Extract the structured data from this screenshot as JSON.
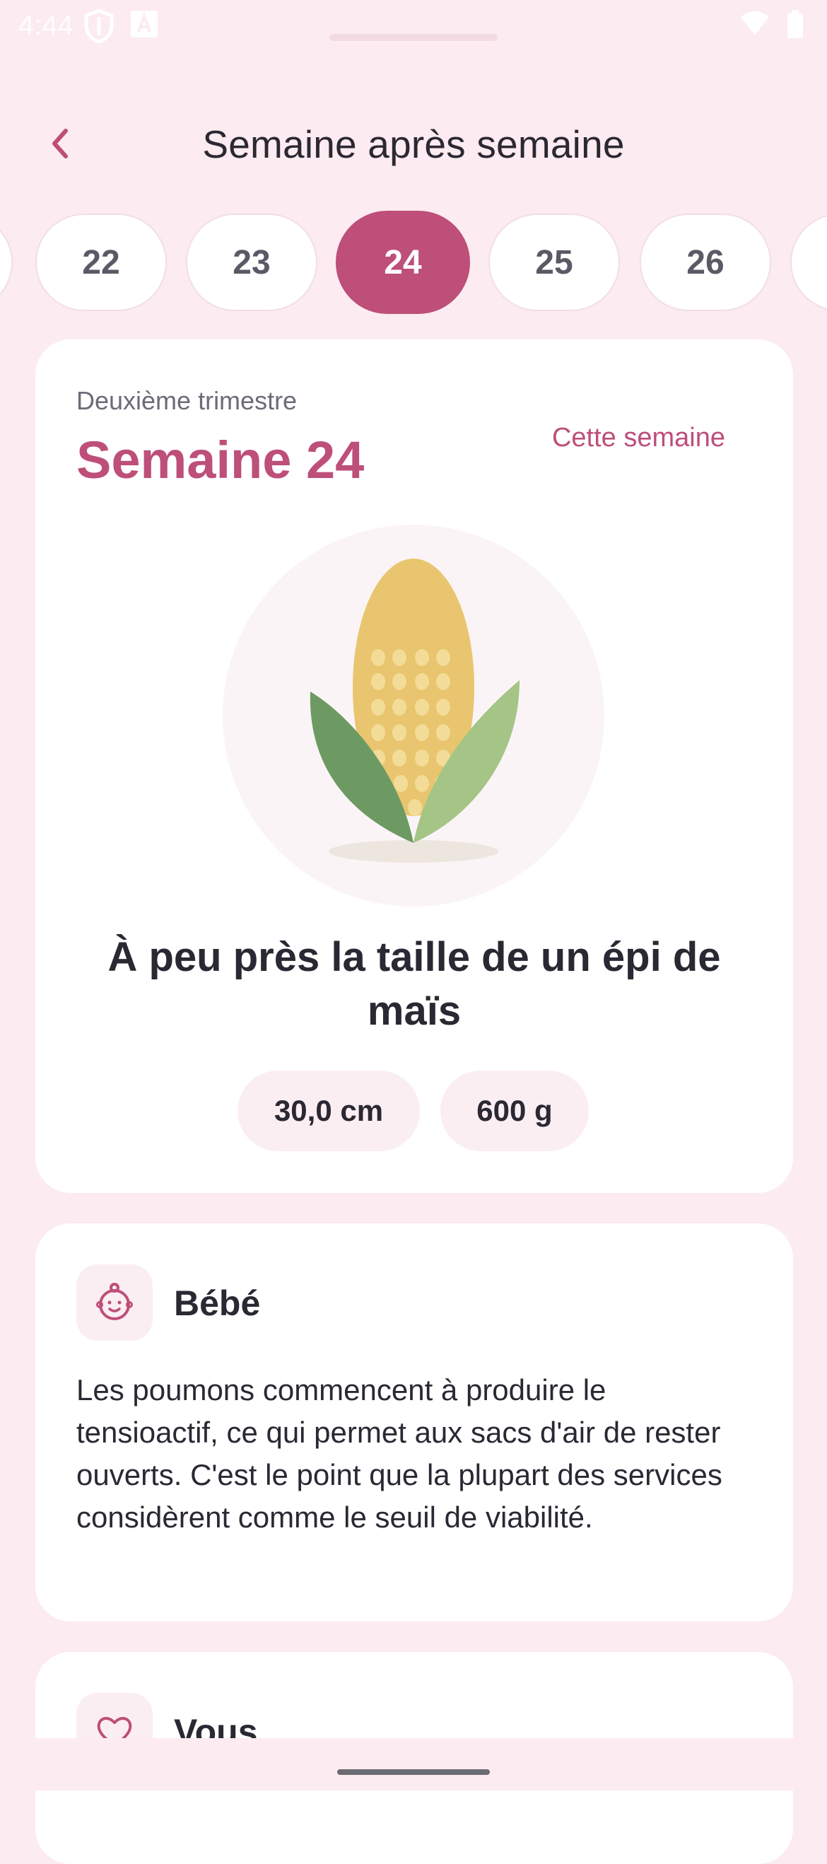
{
  "status_bar": {
    "time": "4:44"
  },
  "header": {
    "title": "Semaine après semaine"
  },
  "weeks": [
    "22",
    "23",
    "24",
    "25",
    "26"
  ],
  "selected_week": "24",
  "summary": {
    "trimester": "Deuxième trimestre",
    "week_heading": "Semaine 24",
    "this_week_label": "Cette semaine",
    "size_text": "À peu près la taille de un épi de maïs",
    "length": "30,0 cm",
    "weight": "600 g",
    "illustration_icon": "corn-illustration"
  },
  "baby": {
    "title": "Bébé",
    "icon": "baby-face-icon",
    "text": "Les poumons commencent à produire le tensioactif, ce qui permet aux sacs d'air de rester ouverts. C'est le point que la plupart des services considèrent comme le seuil de viabilité."
  },
  "you": {
    "title": "Vous",
    "icon": "heart-icon"
  },
  "colors": {
    "accent": "#bd4f79",
    "background": "#fcebf0",
    "card": "#ffffff"
  }
}
